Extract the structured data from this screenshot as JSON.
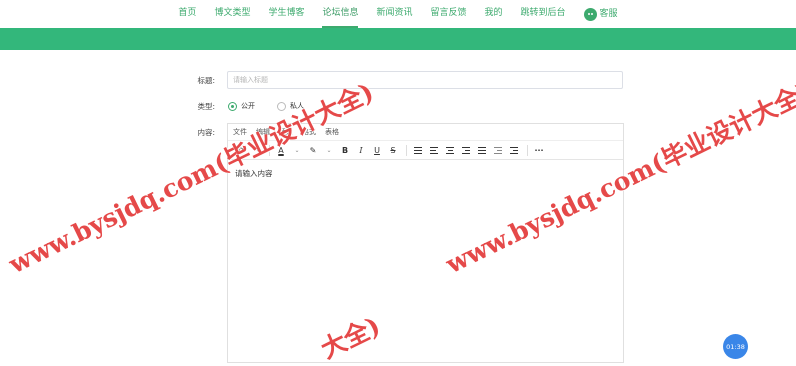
{
  "nav": {
    "items": [
      "首页",
      "博文类型",
      "学生博客",
      "论坛信息",
      "新闻资讯",
      "留言反馈",
      "我的",
      "跳转到后台"
    ],
    "active_index": 3,
    "kefu_label": "客服"
  },
  "form": {
    "title_label": "标题:",
    "title_placeholder": "请输入标题",
    "type_label": "类型:",
    "type_options": [
      "公开",
      "私人"
    ],
    "type_selected": "公开",
    "content_label": "内容:"
  },
  "editor": {
    "menu": [
      "文件",
      "编辑",
      "插入",
      "格式",
      "表格"
    ],
    "placeholder": "请输入内容"
  },
  "timer": "01:38",
  "watermarks": [
    "www.bysjdq.com(毕业设计大全)",
    "www.bysjdq.com(毕业设计大全)",
    "大全)"
  ],
  "colors": {
    "accent": "#33b77b",
    "watermark": "#e02929",
    "timer": "#3a86e8"
  }
}
